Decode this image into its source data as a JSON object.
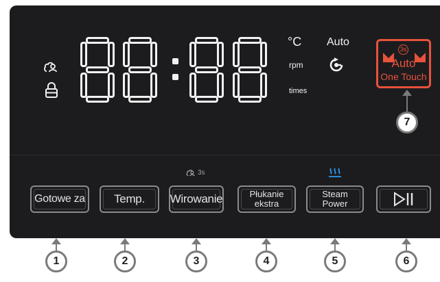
{
  "display": {
    "digits": [
      "8",
      "8",
      "8",
      "8"
    ],
    "unit_celsius": "°C",
    "unit_rpm": "rpm",
    "unit_times": "times",
    "auto_label": "Auto"
  },
  "auto_button": {
    "timer_badge": "3s",
    "line1": "Auto",
    "line2": "One Touch"
  },
  "lock_hint": "3s",
  "buttons": [
    {
      "label": "Gotowe za",
      "callout": "1"
    },
    {
      "label": "Temp.",
      "callout": "2"
    },
    {
      "label": "Wirowanie",
      "callout": "3"
    },
    {
      "label": "Płukanie ekstra",
      "callout": "4"
    },
    {
      "label": "Steam Power",
      "callout": "5"
    },
    {
      "label": "",
      "callout": "6"
    }
  ],
  "buttons_split": {
    "rinse_line1": "Płukanie",
    "rinse_line2": "ekstra",
    "steam_line1": "Steam",
    "steam_line2": "Power"
  },
  "auto_callout": "7",
  "colors": {
    "panel": "#1c1c1f",
    "accent_red": "#e8523a",
    "steam_blue": "#2a9df4",
    "segment": "#f2f2f2"
  }
}
